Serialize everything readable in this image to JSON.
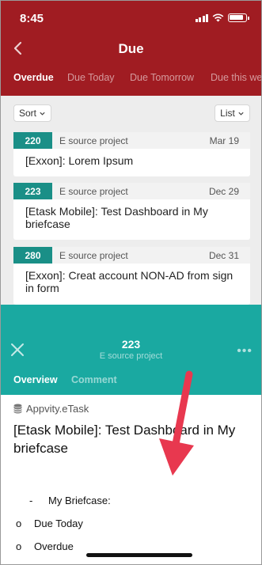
{
  "status_bar": {
    "time": "8:45"
  },
  "header": {
    "title": "Due",
    "tabs": [
      {
        "label": "Overdue",
        "active": true
      },
      {
        "label": "Due Today",
        "active": false
      },
      {
        "label": "Due Tomorrow",
        "active": false
      },
      {
        "label": "Due this we",
        "active": false
      }
    ]
  },
  "toolbar": {
    "sort_label": "Sort",
    "view_label": "List"
  },
  "tasks": [
    {
      "id": "220",
      "project": "E source project",
      "date": "Mar 19",
      "title": "[Exxon]: Lorem Ipsum"
    },
    {
      "id": "223",
      "project": "E source project",
      "date": "Dec 29",
      "title": "[Etask Mobile]: Test Dashboard in My briefcase"
    },
    {
      "id": "280",
      "project": "E source project",
      "date": "Dec 31",
      "title": "[Exxon]: Creat account NON-AD from sign in form"
    }
  ],
  "detail": {
    "id": "223",
    "project": "E source project",
    "more": "•••",
    "tabs": [
      {
        "label": "Overview",
        "active": true
      },
      {
        "label": "Comment",
        "active": false
      }
    ],
    "app_name": "Appvity.eTask",
    "title": "[Etask Mobile]: Test Dashboard in My briefcase",
    "bullets": [
      {
        "marker": "-",
        "text": "My Briefcase:"
      },
      {
        "marker": "o",
        "text": "Due Today"
      },
      {
        "marker": "o",
        "text": "Overdue"
      }
    ]
  },
  "colors": {
    "header_bg": "#a01c22",
    "teal_badge": "#1a8f87",
    "detail_header": "#1aa9a1",
    "annotation_arrow": "#e8384f"
  },
  "icons": [
    "back-chevron-icon",
    "signal-icon",
    "wifi-icon",
    "battery-icon",
    "chevron-down-icon",
    "close-icon",
    "more-dots-icon",
    "database-icon",
    "annotation-arrow"
  ]
}
